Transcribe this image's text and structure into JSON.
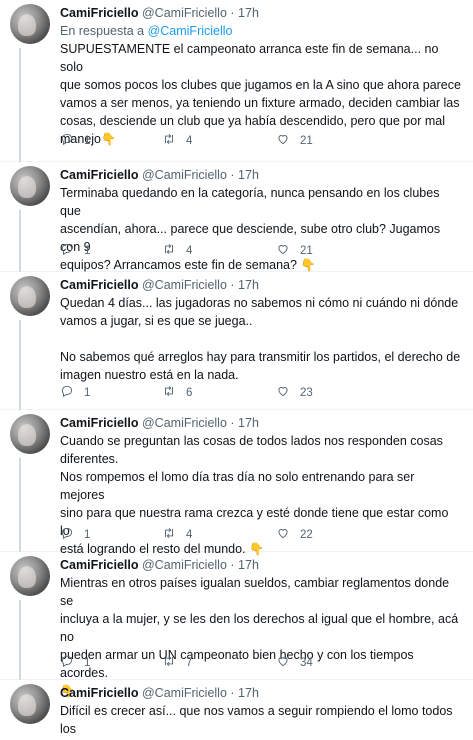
{
  "author": {
    "display_name": "CamiFriciello",
    "handle": "@CamiFriciello",
    "separator": "·",
    "timestamp": "17h"
  },
  "reply_context": {
    "prefix": "En respuesta a",
    "mention": "@CamiFriciello"
  },
  "tweets": [
    {
      "text": "SUPUESTAMENTE el campeonato arranca este fin de semana... no solo\nque somos pocos los clubes que jugamos en la A sino que ahora parece\nvamos a ser menos, ya teniendo un fixture armado, deciden cambiar las\ncosas, desciende un club que ya había descendido, pero que por mal\nmanejo",
      "emoji": "👇",
      "replies": "1",
      "retweets": "4",
      "likes": "21"
    },
    {
      "text": "Terminaba quedando en la categoría, nunca pensando en los clubes que\nascendían, ahora... parece que desciende, sube otro club? Jugamos con 9\nequipos? Arrancamos este fin de semana?",
      "emoji": "👇",
      "replies": "1",
      "retweets": "4",
      "likes": "21"
    },
    {
      "text": "Quedan 4 días... las jugadoras no sabemos ni cómo ni cuándo ni dónde\nvamos a jugar, si es que se juega..\n\nNo sabemos qué arreglos hay para transmitir los partidos, el derecho de\nimagen nuestro está en la nada.",
      "emoji": "",
      "replies": "1",
      "retweets": "6",
      "likes": "23"
    },
    {
      "text": "Cuando se preguntan las cosas de todos lados nos responden cosas\ndiferentes.\nNos rompemos el lomo día tras día no solo entrenando para ser mejores\nsino para que nuestra rama crezca y esté donde tiene que estar como lo\nestá logrando el resto del mundo.",
      "emoji": "👇",
      "replies": "1",
      "retweets": "4",
      "likes": "22"
    },
    {
      "text": "Mientras en otros países igualan sueldos, cambiar reglamentos donde se\nincluya a la mujer, y se les den los derechos al igual que el hombre, acá no\npueden armar un UN campeonato bien hecho y con los tiempos acordes.\n",
      "emoji": "👇",
      "replies": "1",
      "retweets": "7",
      "likes": "34"
    },
    {
      "text": "Difícil es crecer así... que nos vamos a seguir rompiendo el lomo todos los\ndías lo vamos a seguir haciendo, pero por favor algo tiene que cambiar.",
      "emoji": "",
      "replies": "",
      "retweets": "",
      "likes": ""
    }
  ],
  "icons": {
    "reply": "reply-icon",
    "retweet": "retweet-icon",
    "like": "heart-icon"
  },
  "colors": {
    "text": "#0f1419",
    "muted": "#536471",
    "link": "#1d9bf0",
    "thread_line": "#cfd9de"
  }
}
